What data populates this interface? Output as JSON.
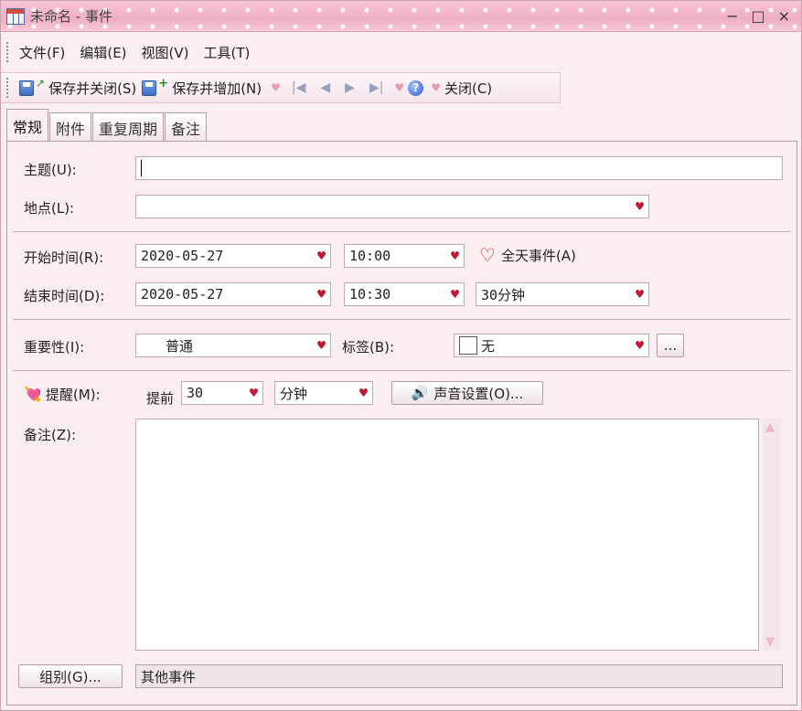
{
  "window": {
    "title": "未命名 - 事件",
    "controls": [
      "−",
      "□",
      "×"
    ]
  },
  "menu": [
    "文件(F)",
    "编辑(E)",
    "视图(V)",
    "工具(T)"
  ],
  "toolbar": {
    "save_close": "保存并关闭(S)",
    "save_add": "保存并增加(N)",
    "close": "关闭(C)"
  },
  "tabs": [
    "常规",
    "附件",
    "重复周期",
    "备注"
  ],
  "form": {
    "subject_label": "主题(U):",
    "subject_value": "",
    "location_label": "地点(L):",
    "location_value": "",
    "start_label": "开始时间(R):",
    "start_date": "2020-05-27",
    "start_time": "10:00",
    "all_day_label": "全天事件(A)",
    "end_label": "结束时间(D):",
    "end_date": "2020-05-27",
    "end_time": "10:30",
    "duration": "30分钟",
    "importance_label": "重要性(I):",
    "importance_value": "普通",
    "tag_label": "标签(B):",
    "tag_value": "无",
    "tag_more": "...",
    "reminder_label": "提醒(M):",
    "reminder_before": "提前",
    "reminder_amount": "30",
    "reminder_unit": "分钟",
    "sound_button": "声音设置(O)...",
    "notes_label": "备注(Z):",
    "notes_value": "",
    "group_button": "组别(G)...",
    "group_value": "其他事件"
  },
  "colors": {
    "accent_heart": "#c01830",
    "window_bg": "#fbeef1",
    "title_bar": "#f0b3c7"
  }
}
